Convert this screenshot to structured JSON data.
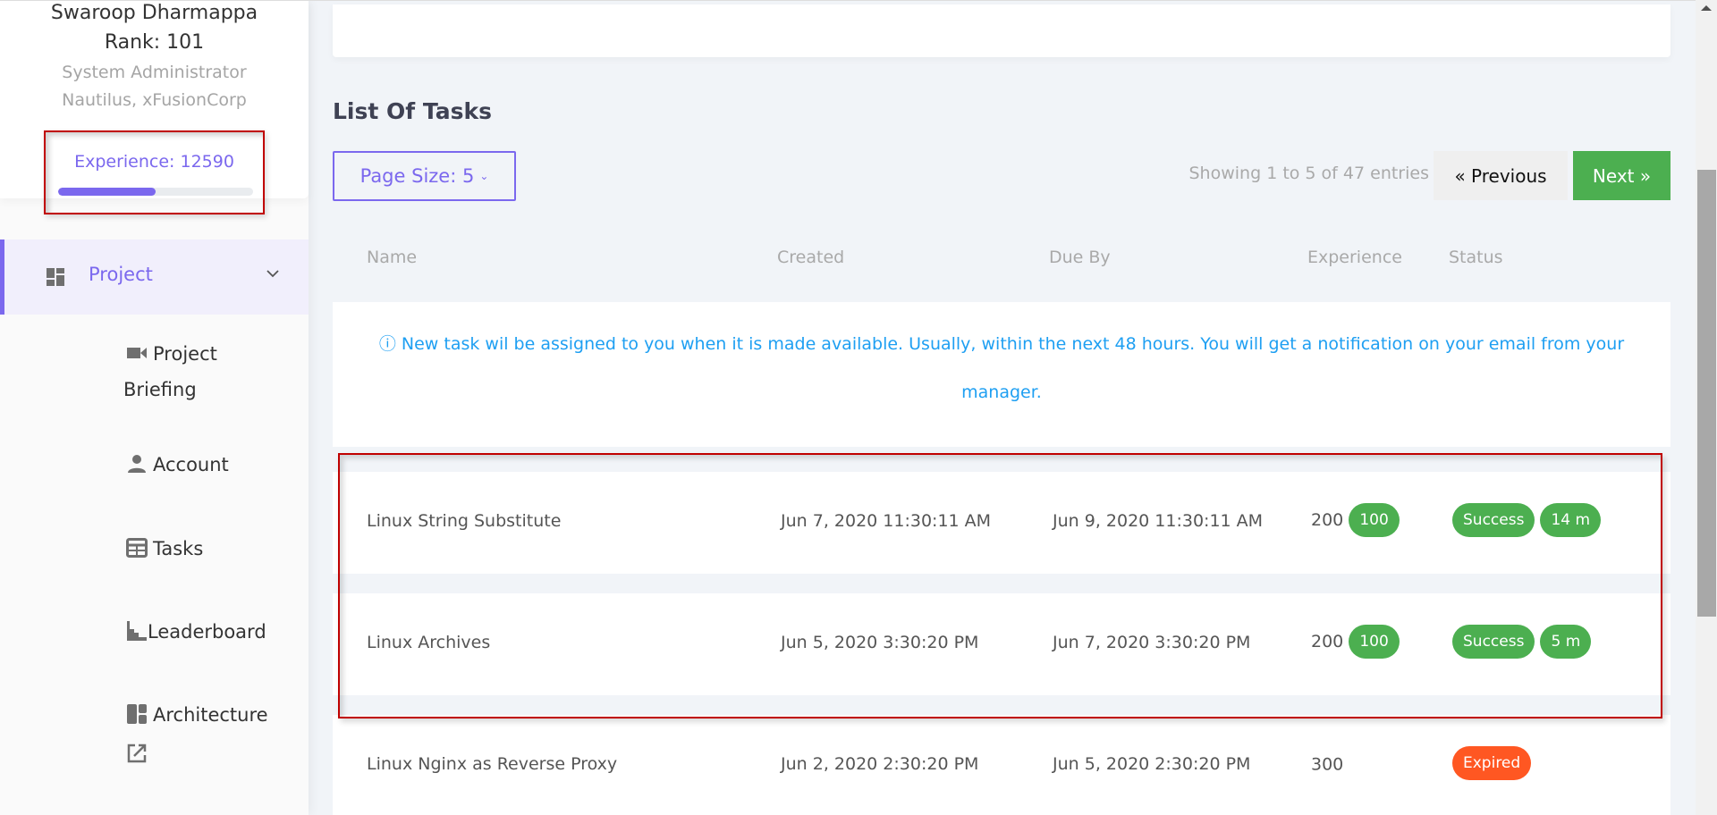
{
  "profile": {
    "name": "Swaroop Dharmappa",
    "rank": "Rank: 101",
    "role": "System Administrator",
    "org": "Nautilus, xFusionCorp",
    "experience_label": "Experience: 12590",
    "experience_progress_percent": 50
  },
  "sidebar": {
    "project": {
      "label": "Project",
      "icon": "dashboard-icon",
      "expanded": true
    },
    "items": [
      {
        "label_line1": "Project",
        "label_line2": "Briefing",
        "icon": "videocam-icon"
      },
      {
        "label": "Account",
        "icon": "person-icon"
      },
      {
        "label": "Tasks",
        "icon": "table-icon"
      },
      {
        "label": "Leaderboard",
        "icon": "leaderboard-icon"
      },
      {
        "label": "Architecture",
        "icon": "architecture-icon",
        "extra_icon": "open-in-new-icon"
      }
    ]
  },
  "main": {
    "title": "List Of Tasks",
    "page_size_label": "Page Size: 5",
    "showing": "Showing 1 to 5 of 47 entries",
    "prev_label": "« Previous",
    "next_label": "Next »",
    "columns": [
      "Name",
      "Created",
      "Due By",
      "Experience",
      "Status"
    ],
    "info_icon": "info-icon",
    "info_text": "ⓘ New task wil be assigned to you when it is made available. Usually, within the next 48 hours. You will get a notification on your email from your manager.",
    "rows": [
      {
        "name": "Linux String Substitute",
        "created": "Jun 7, 2020 11:30:11 AM",
        "due": "Jun 9, 2020 11:30:11 AM",
        "experience": "200",
        "bonus": "100",
        "status": "Success",
        "duration": "14 m"
      },
      {
        "name": "Linux Archives",
        "created": "Jun 5, 2020 3:30:20 PM",
        "due": "Jun 7, 2020 3:30:20 PM",
        "experience": "200",
        "bonus": "100",
        "status": "Success",
        "duration": "5 m"
      },
      {
        "name": "Linux Nginx as Reverse Proxy",
        "created": "Jun 2, 2020 2:30:20 PM",
        "due": "Jun 5, 2020 2:30:20 PM",
        "experience": "300",
        "status": "Expired"
      }
    ]
  },
  "colors": {
    "accent": "#7b68ee",
    "success": "#4caf50",
    "expired": "#ff5722",
    "info": "#1e9ff2",
    "highlight": "#c00000"
  }
}
